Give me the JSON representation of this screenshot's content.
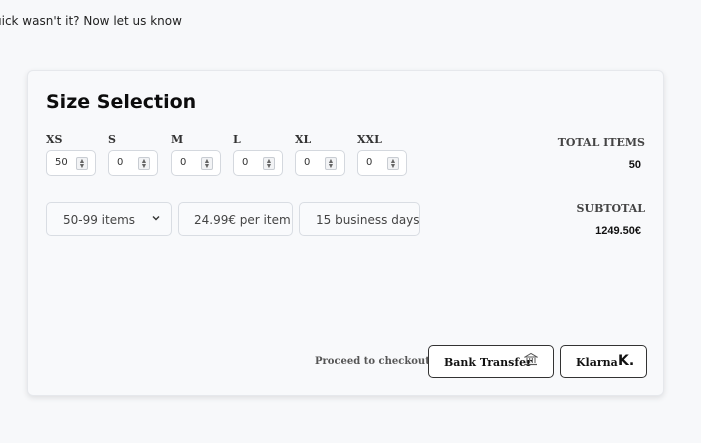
{
  "top_text": "uick wasn't it? Now let us know",
  "card": {
    "title": "Size Selection",
    "sizes": [
      {
        "label": "XS",
        "value": "50"
      },
      {
        "label": "S",
        "value": "0"
      },
      {
        "label": "M",
        "value": "0"
      },
      {
        "label": "L",
        "value": "0"
      },
      {
        "label": "XL",
        "value": "0"
      },
      {
        "label": "XXL",
        "value": "0"
      }
    ],
    "quantity_select": "50-99 items",
    "price_per_item": "24.99€ per item",
    "delivery": "15 business days",
    "total_items_label": "TOTAL ITEMS",
    "total_items_value": "50",
    "subtotal_label": "SUBTOTAL",
    "subtotal_value": "1249.50€",
    "checkout_label": "Proceed to checkout:",
    "bank_transfer_label": "Bank Transfer",
    "klarna_label": "Klarna",
    "klarna_mark": "K."
  }
}
